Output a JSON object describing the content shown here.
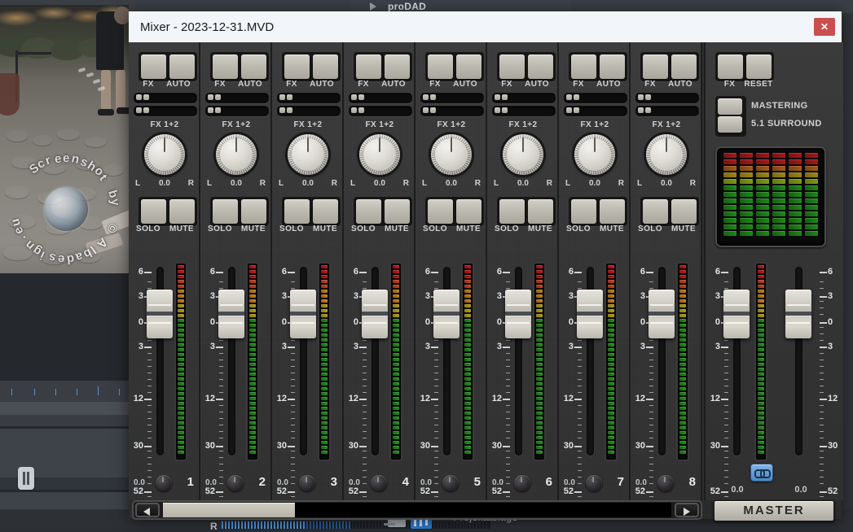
{
  "background": {
    "app_title": "proDAD",
    "watermark": "Screenshot by  © Albadesign.eu",
    "status_label": "Projektablage",
    "meter_channel": "R",
    "meter_scale": [
      "52",
      "30",
      "12",
      "3",
      "0",
      "3",
      "6"
    ]
  },
  "window": {
    "title": "Mixer - 2023-12-31.MVD",
    "close_label": "✕"
  },
  "labels": {
    "fx": "FX",
    "auto": "AUTO",
    "reset": "RESET",
    "fx12": "FX 1+2",
    "solo": "SOLO",
    "mute": "MUTE",
    "pan_left": "L",
    "pan_right": "R",
    "pan_value": "0.0",
    "gain_value": "0.0",
    "mastering": "MASTERING",
    "surround": "5.1 SURROUND",
    "master": "MASTER"
  },
  "fader_scale": [
    "6",
    "3",
    "0",
    "3",
    "12",
    "30",
    "52"
  ],
  "channels": [
    {
      "number": "1",
      "pan": "0.0",
      "gain": "0.0"
    },
    {
      "number": "2",
      "pan": "0.0",
      "gain": "0.0"
    },
    {
      "number": "3",
      "pan": "0.0",
      "gain": "0.0"
    },
    {
      "number": "4",
      "pan": "0.0",
      "gain": "0.0"
    },
    {
      "number": "5",
      "pan": "0.0",
      "gain": "0.0"
    },
    {
      "number": "6",
      "pan": "0.0",
      "gain": "0.0"
    },
    {
      "number": "7",
      "pan": "0.0",
      "gain": "0.0"
    },
    {
      "number": "8",
      "pan": "0.0",
      "gain": "0.0"
    }
  ],
  "master": {
    "left_gain": "0.0",
    "right_gain": "0.0",
    "link_enabled": true,
    "matrix_columns": 6,
    "matrix_rows": 13
  },
  "scrollbar": {
    "left_arrow": "◀",
    "right_arrow": "▶",
    "thumb_fraction": 0.26
  },
  "colors": {
    "accent_close": "#c94f4f",
    "panel": "#343434",
    "button_face": "#bcbab0",
    "link_blue": "#5f95d0",
    "meter_red": "#aa1414",
    "meter_amber": "#b98a12",
    "meter_green": "#1e8a1e"
  }
}
